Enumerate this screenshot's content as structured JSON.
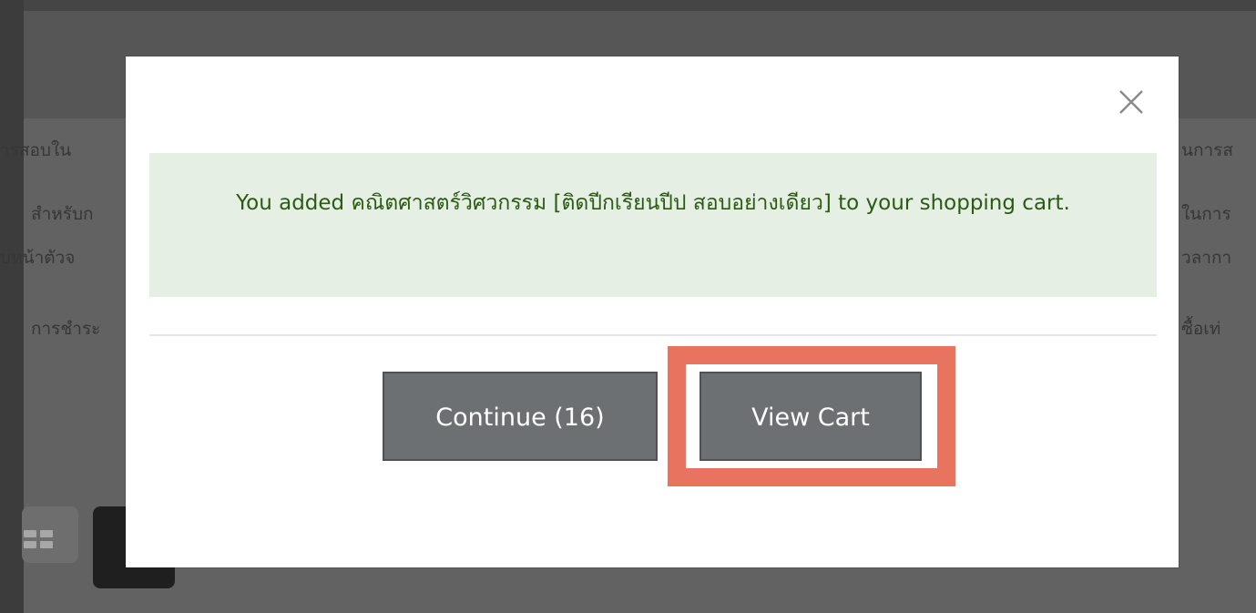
{
  "background": {
    "left_lines": [
      "ารสอบใน",
      "สำหรับก",
      "บหน้าตัวจ",
      "การชำระ"
    ],
    "right_lines": [
      "นการส",
      "ในการ",
      "วลากา",
      "ซื้อเท่"
    ]
  },
  "modal": {
    "message": "You added คณิตศาสตร์วิศวกรรม [ติดปีกเรียนปีป สอบอย่างเดียว] to your shopping cart.",
    "continue_label": "Continue (16)",
    "view_cart_label": "View Cart"
  },
  "colors": {
    "overlay": "#5e5e5e",
    "message_bg": "#e5efe4",
    "message_text": "#2a5b12",
    "button_bg": "#6d7073",
    "highlight": "#e8735e"
  },
  "icons": [
    "close-icon",
    "grid-view-icon",
    "list-view-icon"
  ]
}
